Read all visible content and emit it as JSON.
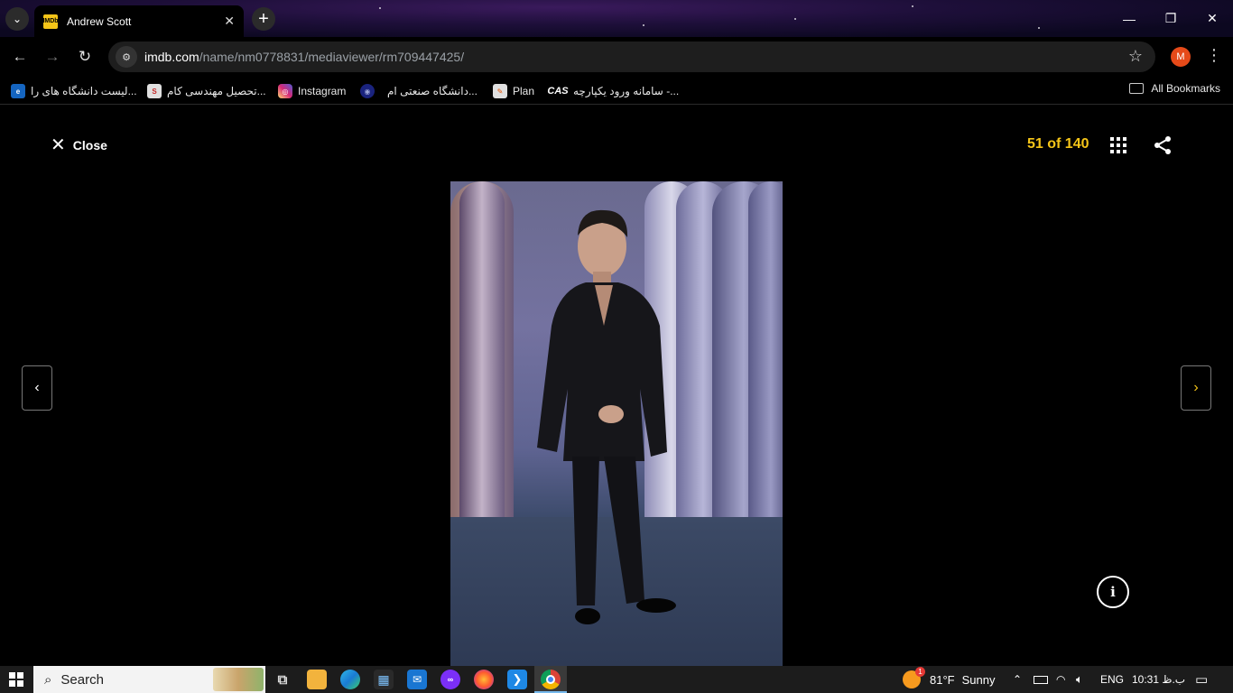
{
  "browser": {
    "tab_title": "Andrew Scott",
    "tab_favicon": "IMDb",
    "url_host": "imdb.com",
    "url_path": "/name/nm0778831/mediaviewer/rm709447425/",
    "profile_initial": "M"
  },
  "bookmarks": {
    "items": [
      {
        "label": "لیست دانشگاه های را...",
        "icon": "e",
        "color": "#1565c0"
      },
      {
        "label": "تحصیل مهندسی کام...",
        "icon": "S",
        "color": "#e0e0e0"
      },
      {
        "label": "Instagram",
        "icon": "◎",
        "color": "#d62976"
      },
      {
        "label": "دانشگاه صنعتی ام...",
        "icon": "◉",
        "color": "#1a237e"
      },
      {
        "label": "Plan",
        "icon": "✎",
        "color": "#e0e0e0"
      },
      {
        "label": "سامانه ورود یکپارچه -...",
        "icon": "CAS",
        "color": "#000000"
      }
    ],
    "all_label": "All Bookmarks"
  },
  "viewer": {
    "close_label": "Close",
    "counter": "51 of 140",
    "accent_color": "#f5c518"
  },
  "taskbar": {
    "search_label": "Search",
    "weather_temp": "81°F",
    "weather_text": "Sunny",
    "weather_badge": "1",
    "language": "ENG",
    "time": "10:31 ب.ظ"
  }
}
